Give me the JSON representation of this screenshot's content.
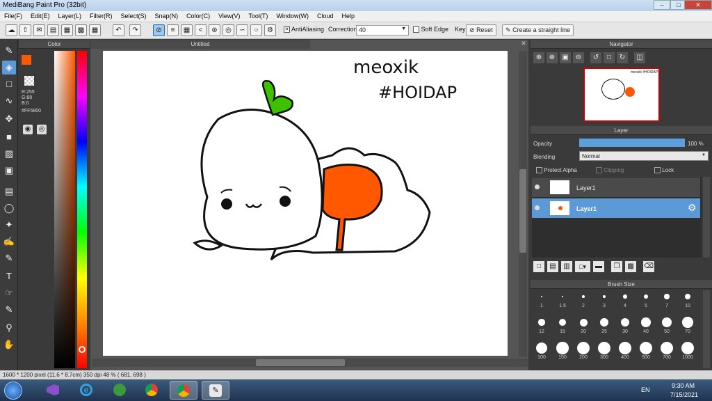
{
  "window": {
    "title": "MediBang Paint Pro (32bit)"
  },
  "menu": [
    "File(F)",
    "Edit(E)",
    "Layer(L)",
    "Filter(R)",
    "Select(S)",
    "Snap(N)",
    "Color(C)",
    "View(V)",
    "Tool(T)",
    "Window(W)",
    "Cloud",
    "Help"
  ],
  "toolbar": {
    "antialias_label": "AntiAliasing",
    "correction_label": "Correction",
    "correction_value": "40",
    "soft_edge_label": "Soft Edge",
    "key_label": "Key",
    "reset_label": "Reset",
    "straight_line_label": "Create a straight line"
  },
  "color_panel": {
    "title": "Color",
    "r": "R:255",
    "g": "G:88",
    "b": "B:0",
    "hex": "#FF5800",
    "fg_color": "#FF5800",
    "bg_color": "#FF1A6E"
  },
  "document": {
    "tab_title": "Untitled"
  },
  "drawing_text": {
    "line1": "meoxik",
    "line2": "#HOIDAP"
  },
  "navigator": {
    "title": "Navigator",
    "thumb_text": "meoxik #HOIDAP"
  },
  "layer_panel": {
    "title": "Layer",
    "opacity_label": "Opacity",
    "opacity_value": "100 %",
    "opacity_fraction": 1.0,
    "blending_label": "Blending",
    "blending_value": "Normal",
    "protect_alpha_label": "Protect Alpha",
    "clipping_label": "Clipping",
    "lock_label": "Lock",
    "layers": [
      {
        "name": "Layer1",
        "selected": false
      },
      {
        "name": "Layer1",
        "selected": true
      }
    ]
  },
  "brush_size": {
    "title": "Brush Size",
    "sizes": [
      "1",
      "1.5",
      "2",
      "3",
      "4",
      "5",
      "7",
      "10",
      "12",
      "15",
      "20",
      "25",
      "30",
      "40",
      "50",
      "70",
      "100",
      "150",
      "200",
      "300",
      "400",
      "500",
      "700",
      "1000"
    ]
  },
  "status": {
    "text": "1600 * 1200 pixel   (11.6 * 8.7cm)   350 dpi   48 %   ( 681, 698 )"
  },
  "taskbar": {
    "lang": "EN",
    "time": "9:30 AM",
    "date": "7/15/2021"
  }
}
